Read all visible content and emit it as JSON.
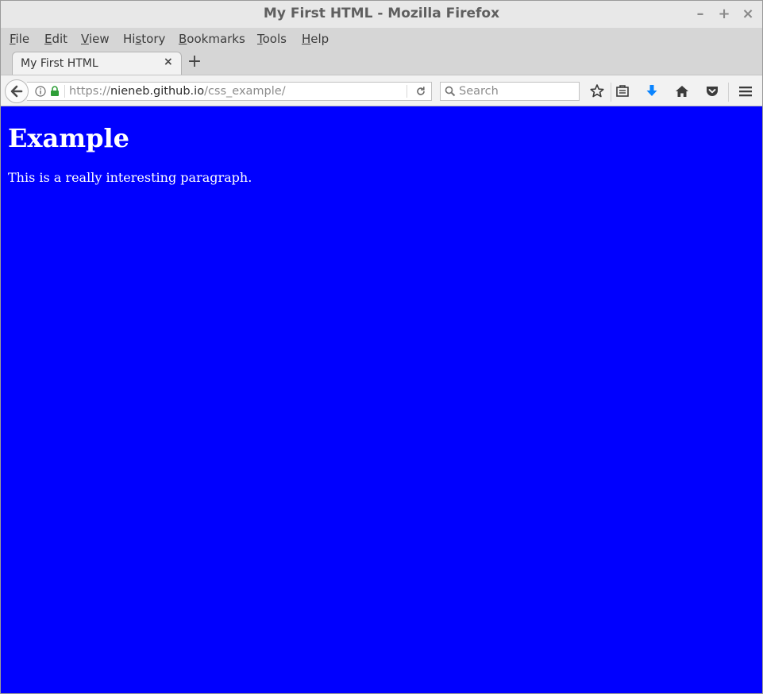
{
  "window": {
    "title": "My First HTML - Mozilla Firefox",
    "minimize": "–",
    "maximize": "+",
    "close": "×"
  },
  "menu": {
    "file": {
      "accel": "F",
      "rest": "ile"
    },
    "edit": {
      "accel": "E",
      "rest": "dit"
    },
    "view": {
      "accel": "V",
      "rest": "iew"
    },
    "history": {
      "pre": "Hi",
      "accel": "s",
      "rest": "tory"
    },
    "bookmarks": {
      "accel": "B",
      "rest": "ookmarks"
    },
    "tools": {
      "accel": "T",
      "rest": "ools"
    },
    "help": {
      "accel": "H",
      "rest": "elp"
    }
  },
  "tabs": [
    {
      "label": "My First HTML",
      "close": "×",
      "active": true
    }
  ],
  "new_tab": "+",
  "navbar": {
    "url_scheme": "https://",
    "url_host": "nieneb.github.io",
    "url_path": "/css_example/",
    "search_placeholder": "Search",
    "icons": [
      "back-icon",
      "info-icon",
      "lock-icon",
      "reload-icon",
      "search-icon",
      "bookmark-star-icon",
      "reading-list-icon",
      "download-icon",
      "home-icon",
      "pocket-icon",
      "menu-icon"
    ]
  },
  "colors": {
    "page_background": "#0000ff",
    "page_text": "#ffffff",
    "lock": "#2e9e38",
    "download": "#0a84ff"
  },
  "page": {
    "heading": "Example",
    "paragraph": "This is a really interesting paragraph."
  }
}
